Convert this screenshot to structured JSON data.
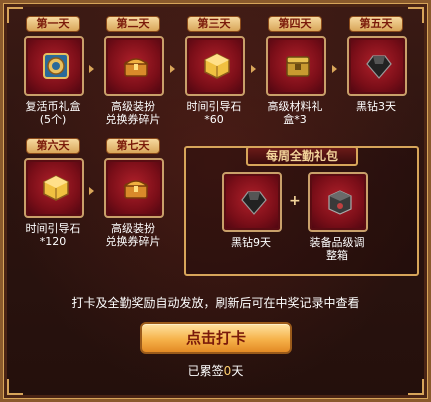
{
  "days": [
    {
      "tab": "第一天",
      "label": "复活币礼盒\n(5个)",
      "icon": "coin-gift-box-icon"
    },
    {
      "tab": "第二天",
      "label": "高级装扮\n兑换券碎片",
      "icon": "treasure-chest-icon"
    },
    {
      "tab": "第三天",
      "label": "时间引导石\n*60",
      "icon": "gold-cube-icon"
    },
    {
      "tab": "第四天",
      "label": "高级材料礼\n盒*3",
      "icon": "material-chest-icon"
    },
    {
      "tab": "第五天",
      "label": "黑钻3天",
      "icon": "black-diamond-icon"
    },
    {
      "tab": "第六天",
      "label": "时间引导石\n*120",
      "icon": "gold-cube-icon"
    },
    {
      "tab": "第七天",
      "label": "高级装扮\n兑换券碎片",
      "icon": "treasure-chest-icon"
    }
  ],
  "weekly": {
    "title": "每周全勤礼包",
    "plus": "+",
    "items": [
      {
        "label": "黑钻9天",
        "icon": "black-diamond-icon"
      },
      {
        "label": "装备品级调\n整箱",
        "icon": "equipment-box-icon"
      }
    ]
  },
  "tip": "打卡及全勤奖励自动发放，刷新后可在中奖记录中查看",
  "sign_button": "点击打卡",
  "signed": {
    "prefix": "已累签",
    "count": "0",
    "suffix": "天"
  },
  "colors": {
    "accent": "#d7a55a",
    "slot": "#8a0e18",
    "button": "#f6b24a",
    "text": "#ffffff"
  }
}
